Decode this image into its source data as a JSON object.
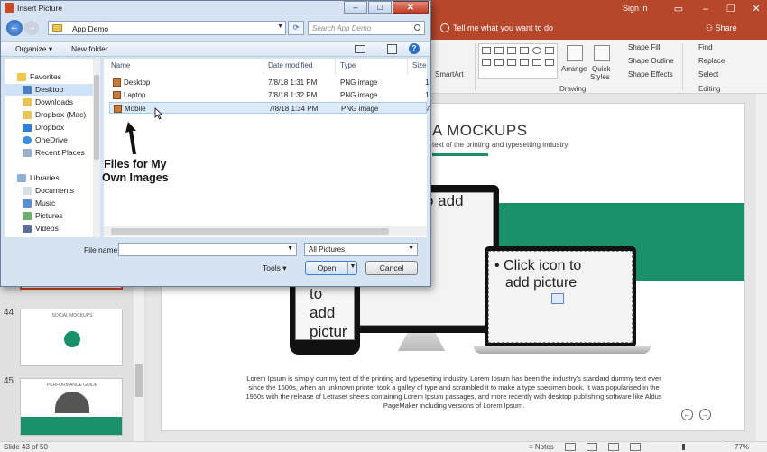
{
  "ppt": {
    "signin": "Sign in",
    "tellme": "Tell me what you want to do",
    "share": "Share",
    "ribbon": {
      "smartart": "SmartArt",
      "arrange": "Arrange",
      "quick_styles_1": "Quick",
      "quick_styles_2": "Styles",
      "shape_fill": "Shape Fill",
      "shape_outline": "Shape Outline",
      "shape_effects": "Shape Effects",
      "find": "Find",
      "replace": "Replace",
      "select": "Select",
      "group_drawing": "Drawing",
      "group_editing": "Editing"
    },
    "thumbnails": [
      {
        "num": "44",
        "title": "SOCIAL MOCKUPS"
      },
      {
        "num": "45",
        "title": "PERFORMANCE GUIDE"
      }
    ],
    "slide": {
      "title": "A MOCKUPS",
      "subtitle": "text of the printing and typesetting industry.",
      "monitor_placeholder": "o add",
      "laptop_placeholder_1": "• Click icon to",
      "laptop_placeholder_2": "add picture",
      "phone_placeholder_1": "to",
      "phone_placeholder_2": "add",
      "phone_placeholder_3": "pictur",
      "lorem": "Lorem Ipsum is simply dummy text of the printing and typesetting industry. Lorem Ipsum has been the industry's standard dummy text ever since the 1500s, when an unknown printer took a galley of type and scrambled it to make a type specimen book. It was popularised in the 1960s with the release of Letraset sheets containing Lorem Ipsum passages, and more recently with desktop publishing software like Aldus PageMaker including versions of Lorem Ipsum."
    },
    "status": {
      "slide_count": "Slide 43 of 50",
      "notes": "Notes",
      "zoom": "77%"
    }
  },
  "dialog": {
    "title": "Insert Picture",
    "address": "App Demo",
    "search_placeholder": "Search App Demo",
    "toolbar": {
      "organize": "Organize ▾",
      "new_folder": "New folder"
    },
    "nav": {
      "favorites": "Favorites",
      "favorites_items": [
        "Desktop",
        "Downloads",
        "Dropbox (Mac)",
        "Dropbox",
        "OneDrive",
        "Recent Places"
      ],
      "libraries": "Libraries",
      "libraries_items": [
        "Documents",
        "Music",
        "Pictures",
        "Videos"
      ]
    },
    "columns": {
      "name": "Name",
      "date": "Date modified",
      "type": "Type",
      "size": "Size"
    },
    "files": [
      {
        "name": "Desktop",
        "date": "7/8/18 1:31 PM",
        "type": "PNG image",
        "size": "1"
      },
      {
        "name": "Laptop",
        "date": "7/8/18 1:32 PM",
        "type": "PNG image",
        "size": "1"
      },
      {
        "name": "Mobile",
        "date": "7/8/18 1:34 PM",
        "type": "PNG image",
        "size": "7"
      }
    ],
    "filename_label": "File name:",
    "filename_value": "",
    "filter": "All Pictures",
    "tools": "Tools",
    "open": "Open",
    "cancel": "Cancel"
  },
  "annotation": {
    "line1": "Files for My",
    "line2": "Own Images"
  },
  "colors": {
    "ppt_accent": "#b7472a",
    "slide_green": "#1a8f6b"
  }
}
